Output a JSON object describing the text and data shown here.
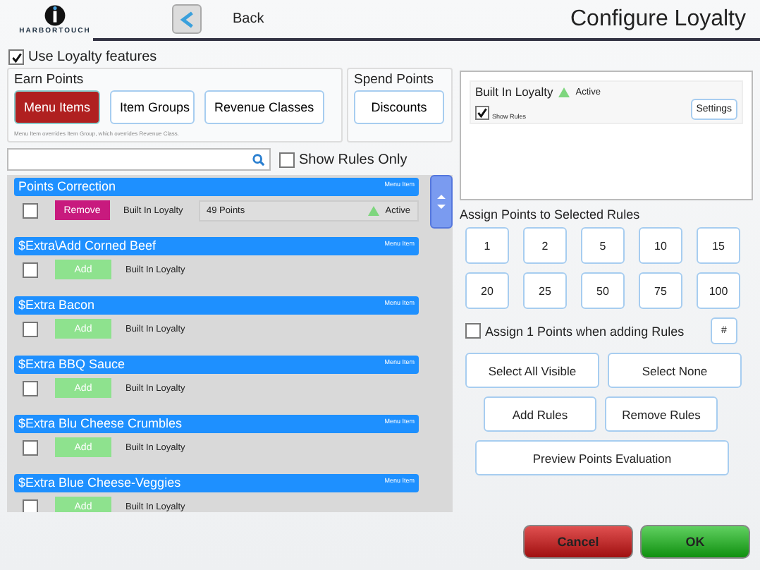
{
  "header": {
    "logo_text": "HARBORTOUCH",
    "back_label": "Back",
    "title": "Configure Loyalty"
  },
  "use_loyalty": {
    "label": "Use Loyalty features",
    "checked": true
  },
  "earn_points": {
    "legend": "Earn Points",
    "options": [
      {
        "label": "Menu Items",
        "selected": true
      },
      {
        "label": "Item Groups",
        "selected": false
      },
      {
        "label": "Revenue Classes",
        "selected": false
      }
    ],
    "note": "Menu Item overrides Item Group, which overrides Revenue Class."
  },
  "spend_points": {
    "legend": "Spend Points",
    "options": [
      {
        "label": "Discounts",
        "selected": false
      }
    ]
  },
  "show_rules_only": {
    "label": "Show Rules Only",
    "checked": false
  },
  "rules": [
    {
      "title": "Points Correction",
      "tag": "Menu Item",
      "checked": false,
      "action": {
        "kind": "remove",
        "label": "Remove"
      },
      "program": "Built In Loyalty",
      "points": "49 Points",
      "status": "Active"
    },
    {
      "title": "$Extra\\Add Corned Beef",
      "tag": "Menu Item",
      "checked": false,
      "action": {
        "kind": "add",
        "label": "Add"
      },
      "program": "Built In Loyalty"
    },
    {
      "title": "$Extra Bacon",
      "tag": "Menu Item",
      "checked": false,
      "action": {
        "kind": "add",
        "label": "Add"
      },
      "program": "Built In Loyalty"
    },
    {
      "title": "$Extra BBQ Sauce",
      "tag": "Menu Item",
      "checked": false,
      "action": {
        "kind": "add",
        "label": "Add"
      },
      "program": "Built In Loyalty"
    },
    {
      "title": "$Extra Blu Cheese Crumbles",
      "tag": "Menu Item",
      "checked": false,
      "action": {
        "kind": "add",
        "label": "Add"
      },
      "program": "Built In Loyalty"
    },
    {
      "title": "$Extra Blue Cheese-Veggies",
      "tag": "Menu Item",
      "checked": false,
      "action": {
        "kind": "add",
        "label": "Add"
      },
      "program": "Built In Loyalty"
    }
  ],
  "program_panel": {
    "name": "Built In Loyalty",
    "status": "Active",
    "show_rules": {
      "label": "Show Rules",
      "checked": true
    },
    "settings_label": "Settings"
  },
  "assign": {
    "heading": "Assign Points to Selected Rules",
    "values": [
      "1",
      "2",
      "5",
      "10",
      "15",
      "20",
      "25",
      "50",
      "75",
      "100"
    ],
    "auto_assign": {
      "label": "Assign 1 Points when adding Rules",
      "checked": false
    },
    "hash_label": "#"
  },
  "actions": [
    [
      "Select All Visible",
      "Select None"
    ],
    [
      "Add Rules",
      "Remove Rules"
    ],
    [
      "Preview Points Evaluation"
    ]
  ],
  "footer": {
    "cancel": "Cancel",
    "ok": "OK"
  }
}
